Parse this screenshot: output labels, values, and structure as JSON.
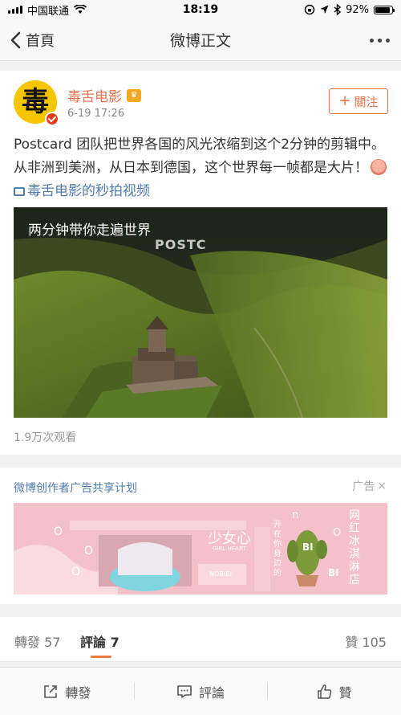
{
  "status_bar": {
    "carrier": "中国联通",
    "time": "18:19",
    "battery_percent": "92%",
    "battery_level": 0.92
  },
  "nav": {
    "back_label": "首頁",
    "title": "微博正文"
  },
  "post": {
    "username": "毒舌电影",
    "avatar_glyph": "毒",
    "time": "6-19 17:26",
    "follow_label": "關注",
    "text_main": "Postcard 团队把世界各国的风光浓缩到这个2分钟的剪辑中。从非洲到美洲，从日本到德国，这个世界每一帧都是大片！",
    "video_link": "毒舌电影的秒拍视频",
    "video_caption": "两分钟带你走遍世界",
    "video_watermark": "POSTC",
    "view_count": "1.9万次观看"
  },
  "ad": {
    "title": "微博创作者广告共享计划",
    "label": "广告",
    "close": "×",
    "banner_text_main": "少女心",
    "banner_text_sub": "GIRL HEART",
    "banner_vertical_1": "开在你身边的",
    "banner_vertical_2": "网红冰淇淋店",
    "banner_box_label": "NOBIBI",
    "banner_letters": [
      "O",
      "O",
      "O",
      "n",
      "O",
      "BI",
      "BI"
    ]
  },
  "tabs": {
    "repost": "轉發 57",
    "comment": "評論 7",
    "like": "贊 105"
  },
  "bottom_bar": {
    "repost": "轉發",
    "comment": "評論",
    "like": "贊"
  },
  "colors": {
    "accent": "#eb7350",
    "link": "#507daf",
    "tab_underline": "#f07b3f"
  }
}
